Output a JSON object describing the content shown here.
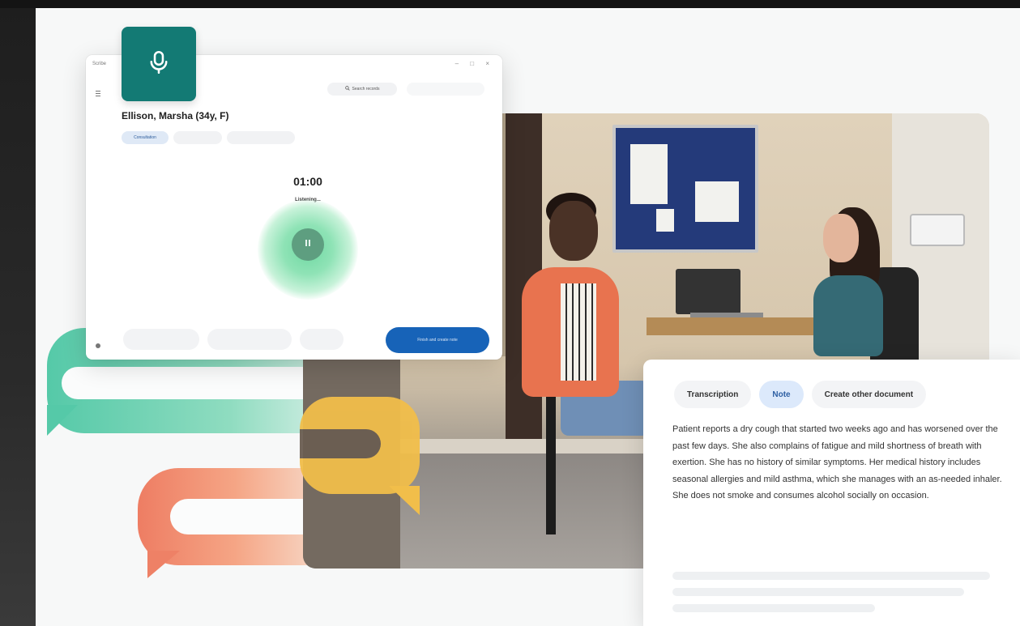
{
  "window": {
    "title": "Scribe",
    "controls": "– □ ×",
    "patient_name": "Ellison, Marsha (34y, F)",
    "chip_label": "Consultation",
    "top_button_label": "Search records",
    "timer": "01:00",
    "status": "Listening...",
    "primary_button_label": "Finish and create note"
  },
  "note_card": {
    "tabs": [
      {
        "label": "Transcription",
        "active": false
      },
      {
        "label": "Note",
        "active": true
      },
      {
        "label": "Create other document",
        "active": false
      }
    ],
    "body": "Patient reports a dry cough that started two weeks ago and has worsened over the past few days. She also complains of fatigue and mild shortness of breath with exertion. She has no history of similar symptoms. Her medical history includes seasonal allergies and mild asthma, which she manages with an as-needed inhaler. She does not smoke and consumes alcohol socially on occasion."
  },
  "colors": {
    "accent_teal": "#137a74",
    "primary_blue": "#1763b8",
    "listening_green": "#6fd8a2",
    "bubble_green": "#55c9a8",
    "bubble_yellow": "#f1be4a",
    "bubble_orange": "#ee7d63"
  },
  "icons": {
    "mic_tile": "microphone-icon",
    "pause": "pause-icon",
    "menu": "menu-icon"
  }
}
